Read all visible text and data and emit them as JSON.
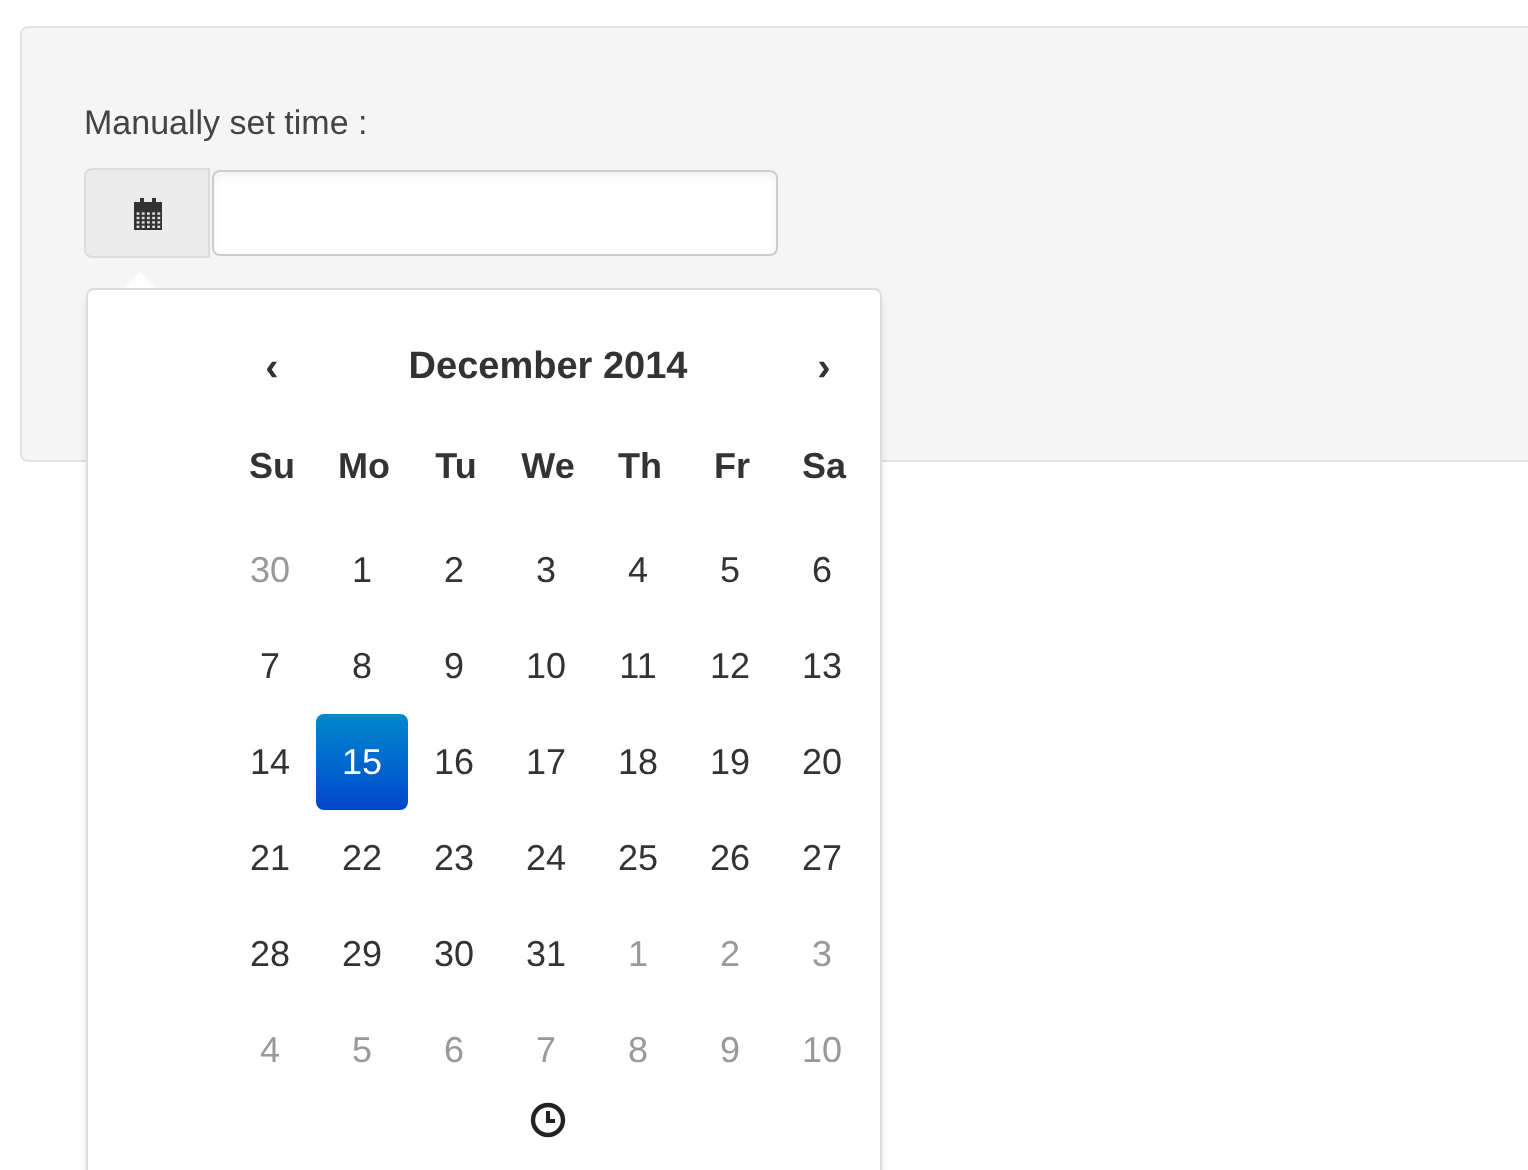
{
  "label": "Manually set time :",
  "calendar": {
    "prev": "‹",
    "title": "December 2014",
    "next": "›",
    "weekdays": [
      "Su",
      "Mo",
      "Tu",
      "We",
      "Th",
      "Fr",
      "Sa"
    ],
    "weeks": [
      [
        {
          "day": "30",
          "muted": true,
          "selected": false
        },
        {
          "day": "1",
          "muted": false,
          "selected": false
        },
        {
          "day": "2",
          "muted": false,
          "selected": false
        },
        {
          "day": "3",
          "muted": false,
          "selected": false
        },
        {
          "day": "4",
          "muted": false,
          "selected": false
        },
        {
          "day": "5",
          "muted": false,
          "selected": false
        },
        {
          "day": "6",
          "muted": false,
          "selected": false
        }
      ],
      [
        {
          "day": "7",
          "muted": false,
          "selected": false
        },
        {
          "day": "8",
          "muted": false,
          "selected": false
        },
        {
          "day": "9",
          "muted": false,
          "selected": false
        },
        {
          "day": "10",
          "muted": false,
          "selected": false
        },
        {
          "day": "11",
          "muted": false,
          "selected": false
        },
        {
          "day": "12",
          "muted": false,
          "selected": false
        },
        {
          "day": "13",
          "muted": false,
          "selected": false
        }
      ],
      [
        {
          "day": "14",
          "muted": false,
          "selected": false
        },
        {
          "day": "15",
          "muted": false,
          "selected": true
        },
        {
          "day": "16",
          "muted": false,
          "selected": false
        },
        {
          "day": "17",
          "muted": false,
          "selected": false
        },
        {
          "day": "18",
          "muted": false,
          "selected": false
        },
        {
          "day": "19",
          "muted": false,
          "selected": false
        },
        {
          "day": "20",
          "muted": false,
          "selected": false
        }
      ],
      [
        {
          "day": "21",
          "muted": false,
          "selected": false
        },
        {
          "day": "22",
          "muted": false,
          "selected": false
        },
        {
          "day": "23",
          "muted": false,
          "selected": false
        },
        {
          "day": "24",
          "muted": false,
          "selected": false
        },
        {
          "day": "25",
          "muted": false,
          "selected": false
        },
        {
          "day": "26",
          "muted": false,
          "selected": false
        },
        {
          "day": "27",
          "muted": false,
          "selected": false
        }
      ],
      [
        {
          "day": "28",
          "muted": false,
          "selected": false
        },
        {
          "day": "29",
          "muted": false,
          "selected": false
        },
        {
          "day": "30",
          "muted": false,
          "selected": false
        },
        {
          "day": "31",
          "muted": false,
          "selected": false
        },
        {
          "day": "1",
          "muted": true,
          "selected": false
        },
        {
          "day": "2",
          "muted": true,
          "selected": false
        },
        {
          "day": "3",
          "muted": true,
          "selected": false
        }
      ],
      [
        {
          "day": "4",
          "muted": true,
          "selected": false
        },
        {
          "day": "5",
          "muted": true,
          "selected": false
        },
        {
          "day": "6",
          "muted": true,
          "selected": false
        },
        {
          "day": "7",
          "muted": true,
          "selected": false
        },
        {
          "day": "8",
          "muted": true,
          "selected": false
        },
        {
          "day": "9",
          "muted": true,
          "selected": false
        },
        {
          "day": "10",
          "muted": true,
          "selected": false
        }
      ]
    ]
  }
}
